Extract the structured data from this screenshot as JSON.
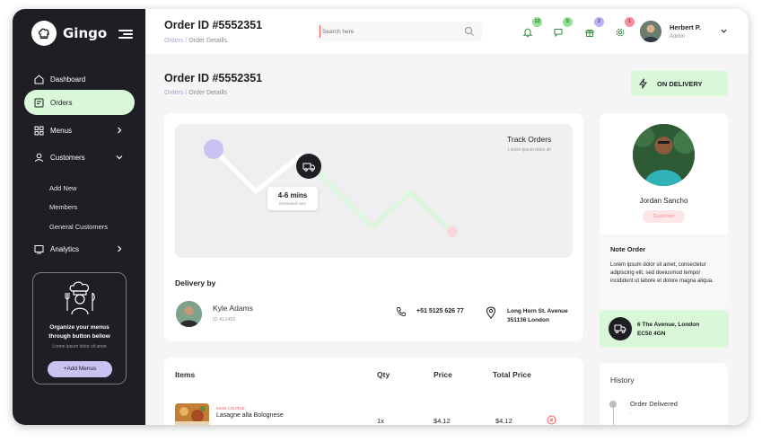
{
  "app": {
    "name": "Gingo"
  },
  "sidebar": {
    "items": [
      {
        "label": "Dashboard"
      },
      {
        "label": "Orders"
      },
      {
        "label": "Menus"
      },
      {
        "label": "Customers"
      },
      {
        "label": "Analytics"
      }
    ],
    "customers_sub": [
      {
        "label": "Add New"
      },
      {
        "label": "Members"
      },
      {
        "label": "General Customers"
      }
    ],
    "promo": {
      "title": "Organize your menus through button bellow",
      "subtitle": "Lorem ipsum dolor sit amet",
      "button": "+Add Menus"
    }
  },
  "topbar": {
    "title": "Order ID #5552351",
    "breadcrumb_link": "Orders",
    "breadcrumb_sep": "/",
    "breadcrumb_current": "Order Detaills",
    "search_placeholder": "Search here",
    "notifications": [
      {
        "icon": "bell-icon",
        "count": "12",
        "color": "#8fe38f"
      },
      {
        "icon": "chat-icon",
        "count": "5",
        "color": "#8fe38f"
      },
      {
        "icon": "gift-icon",
        "count": "2",
        "color": "#b8b0f2"
      },
      {
        "icon": "gear-icon",
        "count": "1",
        "color": "#f58e98"
      }
    ],
    "user": {
      "name": "Herbert P.",
      "role": "Admin"
    }
  },
  "page": {
    "title": "Order ID #5552351",
    "breadcrumb_link": "Orders",
    "breadcrumb_sep": "/",
    "breadcrumb_current": "Order Detaills",
    "status": "ON DELIVERY"
  },
  "tracking": {
    "title": "Track Orders",
    "subtitle": "Lorem ipsum dolor sit",
    "eta_time": "4-6 mins",
    "eta_label": "Estimated time"
  },
  "delivery": {
    "heading": "Delivery by",
    "driver_name": "Kyle Adams",
    "driver_id": "ID 412455",
    "phone": "+51 5125 626 77",
    "address_line1": "Long Horn St. Avenue",
    "address_line2": "351136 London"
  },
  "items_table": {
    "headers": [
      "Items",
      "Qty",
      "Price",
      "Total Price"
    ],
    "rows": [
      {
        "category": "MAIN COURSE",
        "name": "Lasagne alla Bolognese",
        "qty": "1x",
        "price": "$4.12",
        "total": "$4.12"
      }
    ]
  },
  "customer": {
    "name": "Jordan Sancho",
    "tag": "Customer",
    "note_title": "Note Order",
    "note_text": "Lorem ipsum dolor sit amet, consectetur adipiscing elit, sed doeiusmod tempor incididunt ut labore et dolore magna aliqua.",
    "destination_line1": "6 The Avenue, London",
    "destination_line2": "EC50 4GN"
  },
  "history": {
    "title": "History",
    "items": [
      {
        "label": "Order Delivered",
        "sub": "-"
      }
    ]
  },
  "colors": {
    "sidebar_bg": "#1e1e24",
    "accent_green": "#d9f7d9",
    "accent_purple": "#c9c3f2",
    "accent_red": "#f05a5a"
  }
}
